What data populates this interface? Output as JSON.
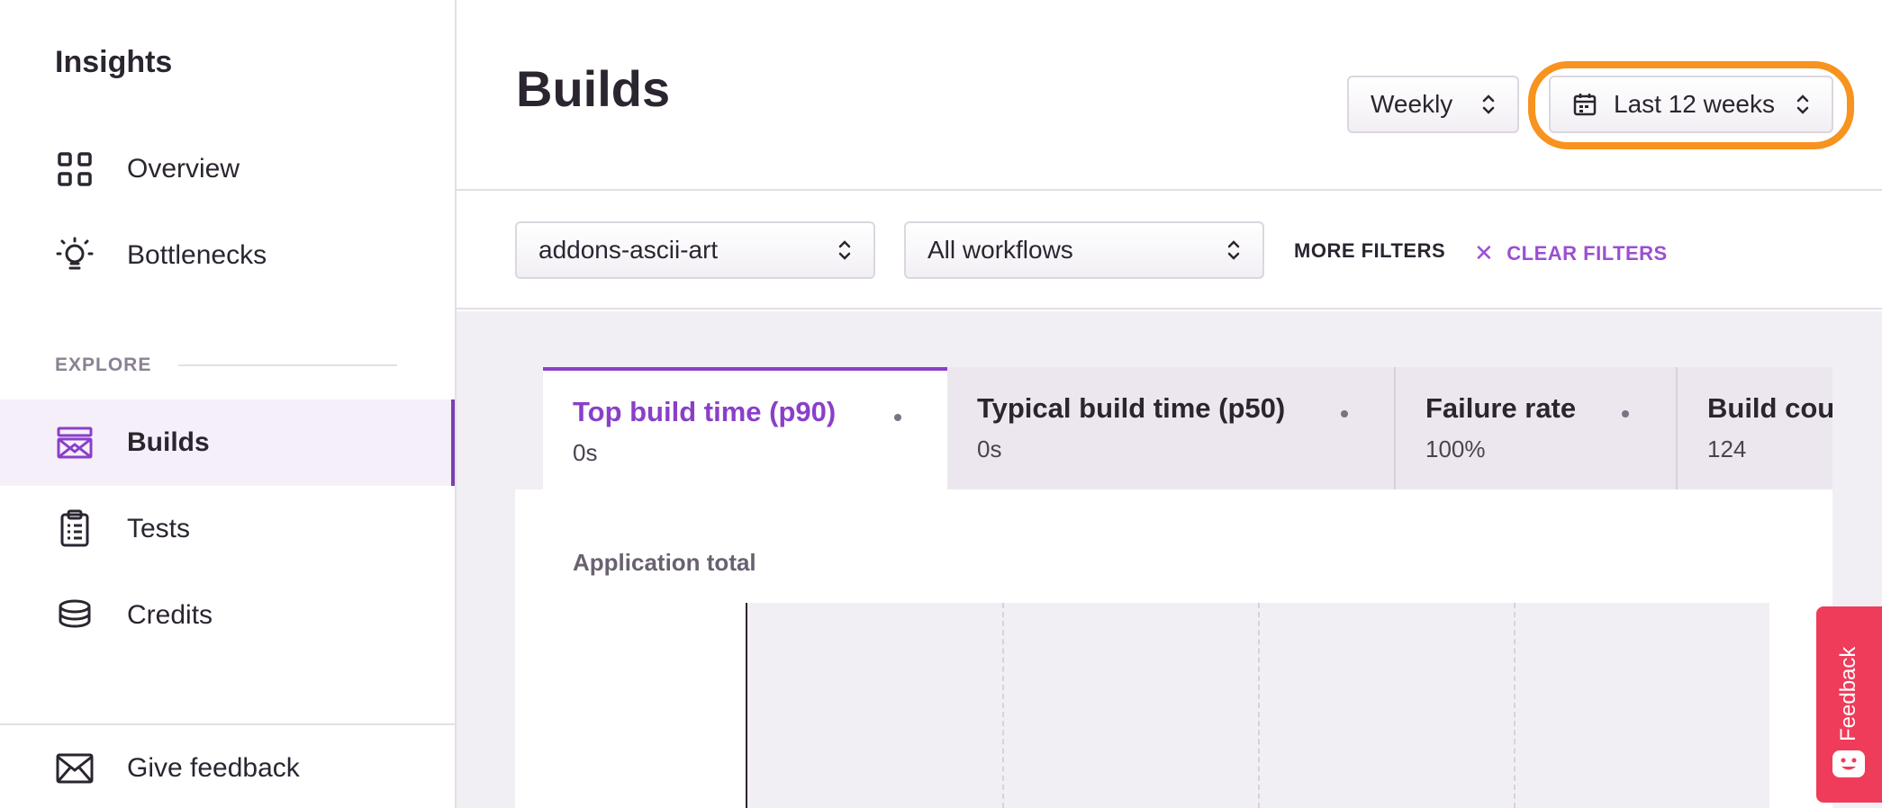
{
  "sidebar": {
    "title": "Insights",
    "items": [
      {
        "label": "Overview",
        "icon": "grid-icon"
      },
      {
        "label": "Bottlenecks",
        "icon": "lightbulb-icon"
      }
    ],
    "section_label": "EXPLORE",
    "explore_items": [
      {
        "label": "Builds",
        "icon": "builds-icon",
        "active": true
      },
      {
        "label": "Tests",
        "icon": "clipboard-icon"
      },
      {
        "label": "Credits",
        "icon": "coins-icon"
      }
    ],
    "footer_item": {
      "label": "Give feedback",
      "icon": "envelope-icon"
    }
  },
  "header": {
    "title": "Builds",
    "interval_select": "Weekly",
    "range_select": "Last 12 weeks"
  },
  "filters": {
    "app_select": "addons-ascii-art",
    "workflow_select": "All workflows",
    "more_filters": "MORE FILTERS",
    "clear_filters": "CLEAR FILTERS"
  },
  "tabs": [
    {
      "title": "Top build time (p90)",
      "value": "0s",
      "active": true
    },
    {
      "title": "Typical build time (p50)",
      "value": "0s"
    },
    {
      "title": "Failure rate",
      "value": "100%"
    },
    {
      "title": "Build count",
      "value": "124"
    }
  ],
  "chart": {
    "title": "Application total"
  },
  "feedback_tab": {
    "label": "Feedback"
  },
  "colors": {
    "accent": "#8a3fc9",
    "highlight": "#f7931e",
    "feedback": "#ee3c5a"
  }
}
